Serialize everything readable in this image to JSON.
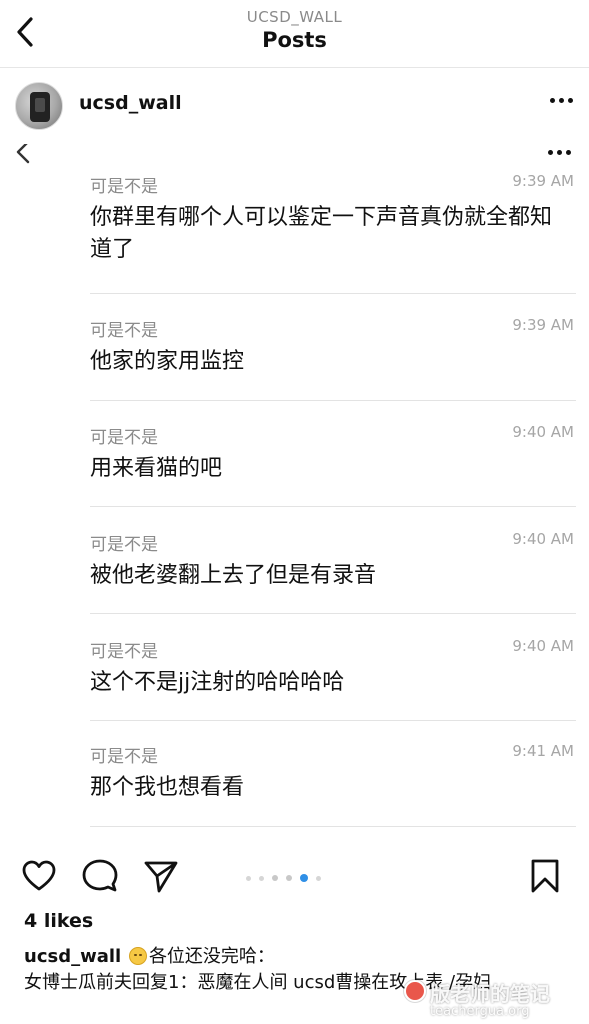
{
  "nav": {
    "account": "UCSD_WALL",
    "title": "Posts"
  },
  "post": {
    "username": "ucsd_wall",
    "likes": "4 likes",
    "caption_user": "ucsd_wall",
    "caption_line1": "各位还没完哈：",
    "caption_line2": "女博士瓜前夫回复1：恶魔在人间 ucsd曹操在玫上表 /孕妇",
    "carousel_total": 6,
    "carousel_active": 4
  },
  "messages": [
    {
      "sender": "可是不是",
      "time": "9:39 AM",
      "text": "你群里有哪个人可以鉴定一下声音真伪就全都知道了"
    },
    {
      "sender": "可是不是",
      "time": "9:39 AM",
      "text": "他家的家用监控"
    },
    {
      "sender": "可是不是",
      "time": "9:40 AM",
      "text": "用来看猫的吧"
    },
    {
      "sender": "可是不是",
      "time": "9:40 AM",
      "text": "被他老婆翻上去了但是有录音"
    },
    {
      "sender": "可是不是",
      "time": "9:40 AM",
      "text": "这个不是jj注射的哈哈哈哈"
    },
    {
      "sender": "可是不是",
      "time": "9:41 AM",
      "text": "那个我也想看看"
    }
  ],
  "watermark": {
    "text": "版老师的笔记",
    "url": "teachergua.org"
  },
  "icons": {
    "back": "chevron-left-icon",
    "more": "more-horizontal-icon",
    "like": "heart-icon",
    "comment": "comment-icon",
    "share": "send-icon",
    "save": "bookmark-icon"
  }
}
